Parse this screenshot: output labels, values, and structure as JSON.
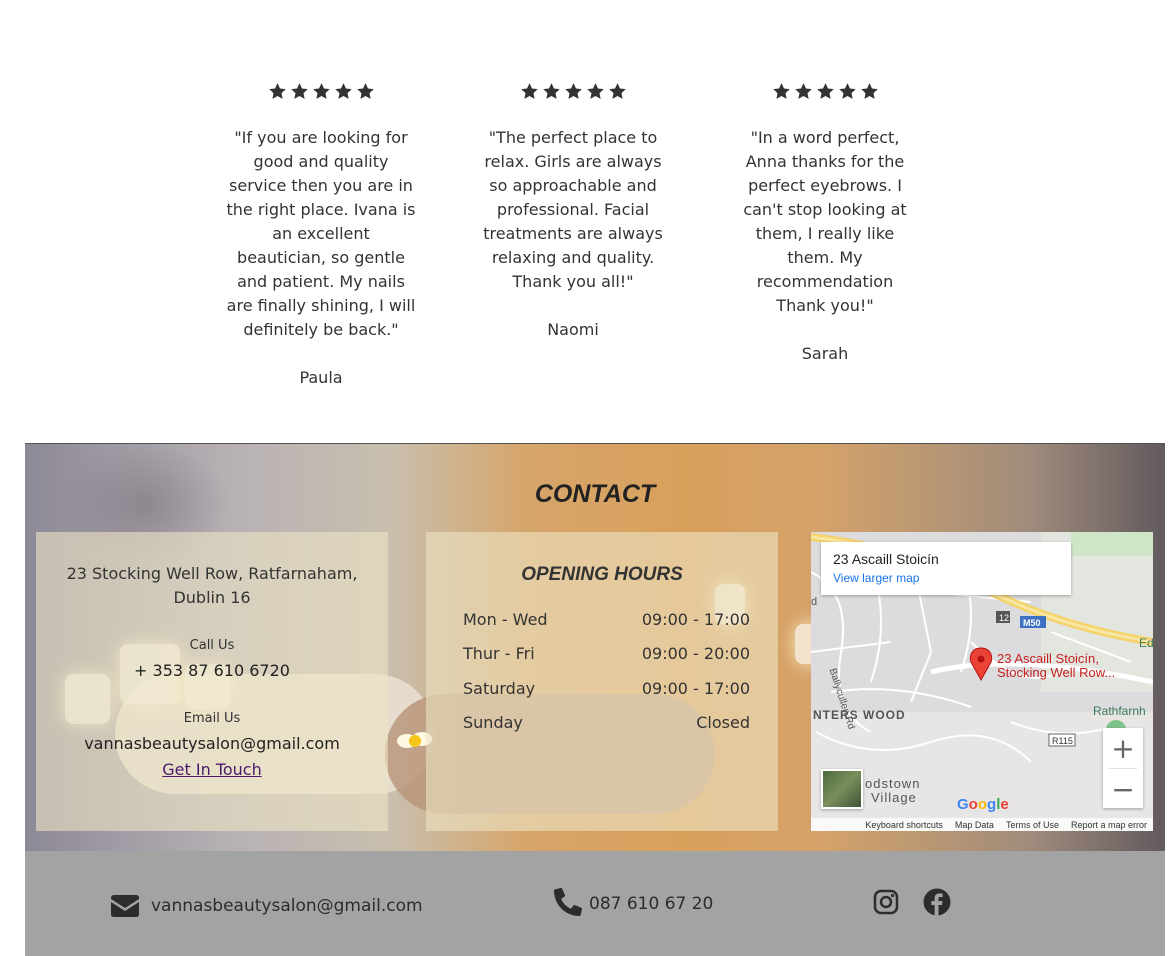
{
  "reviews": [
    {
      "stars": 5,
      "text": "\"If you are looking for good and quality service then you are in the right place. Ivana is an excellent beautician, so gentle and patient. My nails are finally shining, I will definitely be back.\"",
      "author": "Paula"
    },
    {
      "stars": 5,
      "text": "\"The perfect place to relax. Girls are always so approachable and professional. Facial treatments are always relaxing and quality. Thank you all!\"",
      "author": "Naomi"
    },
    {
      "stars": 5,
      "text": "\"In a word perfect, Anna thanks for the perfect eyebrows. I can't stop looking at them, I really like them. My recommendation Thank you!\"",
      "author": "Sarah"
    }
  ],
  "contact": {
    "title": "CONTACT",
    "address": "23 Stocking Well Row, Ratfarnaham, Dublin 16",
    "call_label": "Call Us",
    "phone": "+ 353 87 610 6720",
    "email_label": "Email Us",
    "email": "vannasbeautysalon@gmail.com",
    "get_in_touch": "Get In Touch"
  },
  "hours": {
    "title": "OPENING HOURS",
    "rows": [
      {
        "day": "Mon - Wed",
        "time": "09:00 - 17:00"
      },
      {
        "day": "Thur - Fri",
        "time": "09:00 - 20:00"
      },
      {
        "day": "Saturday",
        "time": "09:00 - 17:00"
      },
      {
        "day": "Sunday",
        "time": "Closed"
      }
    ]
  },
  "map": {
    "place_name": "23 Ascaill Stoicín",
    "view_larger": "View larger map",
    "pin_label_1": "23 Ascaill Stoicín,",
    "pin_label_2": "Stocking Well Row...",
    "area_1": "NTERS WOOD",
    "area_2a": "odstown",
    "area_2b": "Village",
    "area_3": "Rathfarnh",
    "road_1": "Ballycullen Rd",
    "road_2": "R115",
    "road_3": "M50",
    "road_4": "12",
    "edge_label": "Ed",
    "edge_label_2": "d",
    "google": "Google",
    "footer_links": [
      "Keyboard shortcuts",
      "Map Data",
      "Terms of Use",
      "Report a map error"
    ]
  },
  "footer": {
    "email": "vannasbeautysalon@gmail.com",
    "phone": "087 610 67 20",
    "icons": [
      "envelope-icon",
      "phone-icon",
      "instagram-icon",
      "facebook-icon"
    ]
  },
  "colors": {
    "footer_bg": "#a3a3a3",
    "link": "#4b1a6b",
    "pin": "#ea4335"
  }
}
